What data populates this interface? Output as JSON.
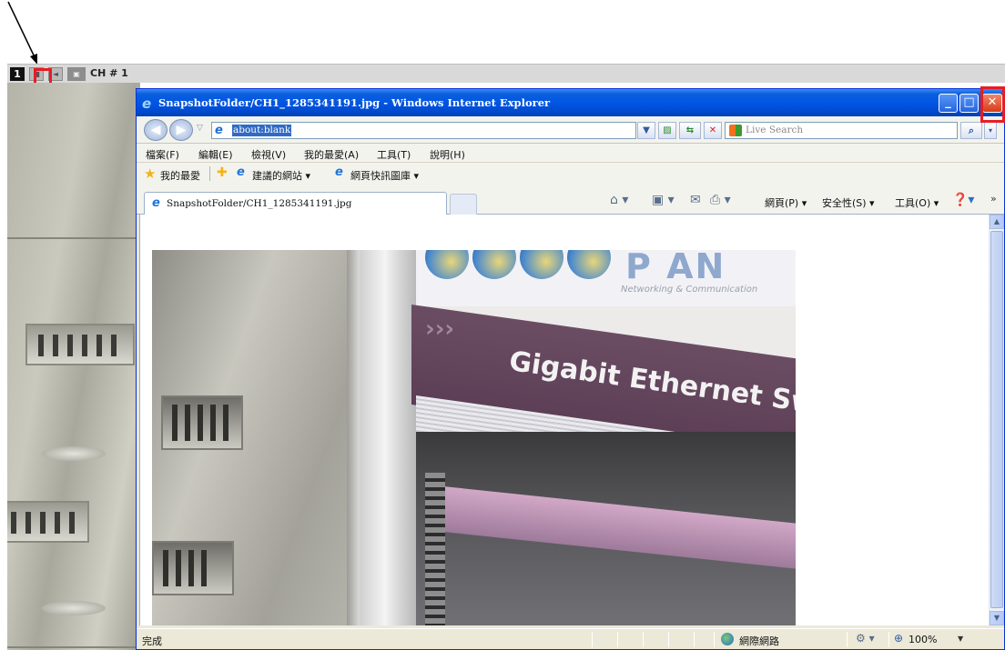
{
  "camera": {
    "channel_number": "1",
    "channel_label": "CH # 1"
  },
  "browser": {
    "title": "SnapshotFolder/CH1_1285341191.jpg - Windows Internet Explorer",
    "address": "about:blank",
    "search_placeholder": "Live Search",
    "menu": [
      "檔案(F)",
      "編輯(E)",
      "檢視(V)",
      "我的最愛(A)",
      "工具(T)",
      "說明(H)"
    ],
    "favorites_label": "我的最愛",
    "favorites_links": [
      "建議的網站 ▾",
      "網頁快訊圖庫 ▾"
    ],
    "tab_title": "SnapshotFolder/CH1_1285341191.jpg",
    "commands": {
      "page": "網頁(P) ▾",
      "safety": "安全性(S) ▾",
      "tools": "工具(O) ▾"
    },
    "status_text": "完成",
    "zone": "網際網路",
    "zoom": "100%"
  },
  "photo": {
    "brand": "P   AN",
    "tagline": "Networking & Communication",
    "sign_text": "Gigabit Ethernet Sw"
  }
}
